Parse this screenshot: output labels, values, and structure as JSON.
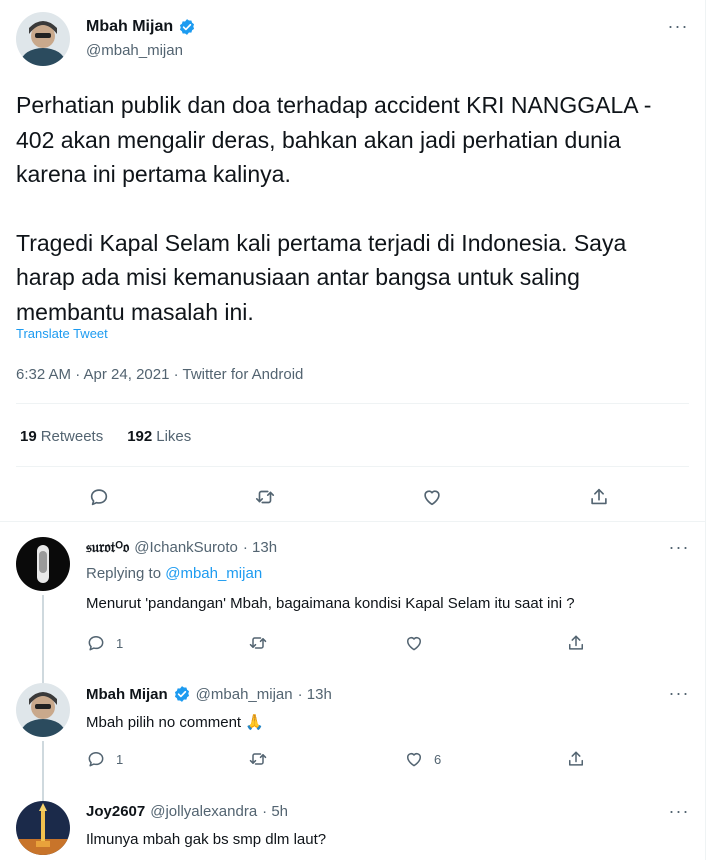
{
  "main_tweet": {
    "display_name": "Mbah Mijan",
    "handle": "@mbah_mijan",
    "verified": true,
    "paragraphs": [
      "Perhatian publik dan doa terhadap accident KRI NANGGALA - 402 akan mengalir deras, bahkan akan jadi perhatian dunia karena ini pertama kalinya.",
      "Tragedi Kapal Selam kali pertama terjadi di Indonesia. Saya harap ada misi kemanusiaan antar bangsa untuk saling membantu masalah ini."
    ],
    "translate_label": "Translate Tweet",
    "meta": "6:32 AM · Apr 24, 2021 · Twitter for Android",
    "retweets_count": "19",
    "retweets_label": "Retweets",
    "likes_count": "192",
    "likes_label": "Likes",
    "actions": [
      "reply-icon",
      "retweet-icon",
      "like-icon",
      "share-icon"
    ]
  },
  "replies": [
    {
      "display_name": "𝔰𝔲𝔯𝔬𝔱ᴼ𝔬",
      "handle": "@IchankSuroto",
      "time": "· 13h",
      "replying_prefix": "Replying to ",
      "replying_to": "@mbah_mijan",
      "text": "Menurut 'pandangan' Mbah, bagaimana kondisi Kapal Selam itu saat ini ?",
      "reply_count": "1",
      "retweet_count": "",
      "like_count": ""
    },
    {
      "display_name": "Mbah Mijan",
      "handle": "@mbah_mijan",
      "time": "· 13h",
      "verified": true,
      "text": "Mbah pilih no comment 🙏",
      "reply_count": "1",
      "retweet_count": "",
      "like_count": "6"
    },
    {
      "display_name": "Joy2607",
      "handle": "@jollyalexandra",
      "time": "· 5h",
      "text": "Ilmunya mbah gak bs smp dlm laut?"
    }
  ],
  "colors": {
    "accent": "#1d9bf0",
    "text": "#0f1419",
    "muted": "#536471",
    "divider": "#eff3f4"
  }
}
